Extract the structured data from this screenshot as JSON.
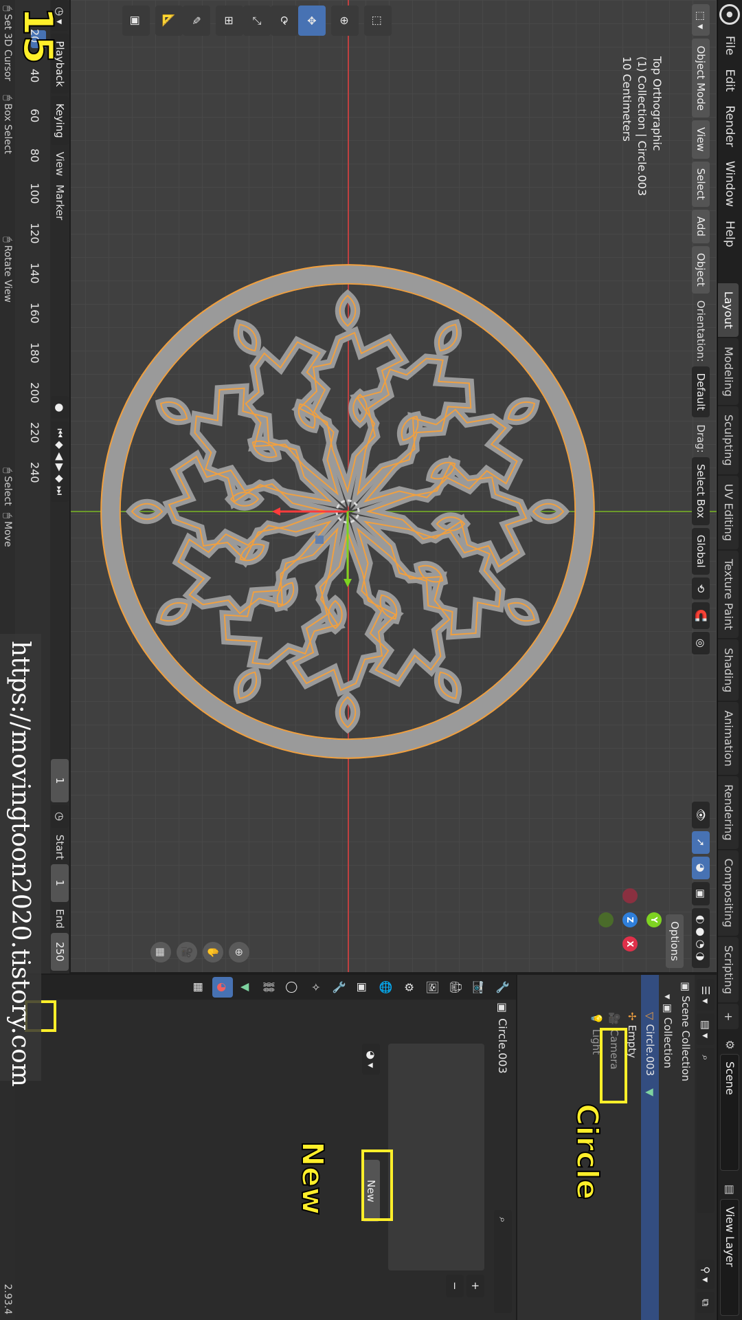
{
  "menu": {
    "items": [
      "File",
      "Edit",
      "Render",
      "Window",
      "Help"
    ]
  },
  "workspaces": [
    "Layout",
    "Modeling",
    "Sculpting",
    "UV Editing",
    "Texture Paint",
    "Shading",
    "Animation",
    "Rendering",
    "Compositing",
    "Scripting"
  ],
  "workspace_add": "+",
  "scene_name": "Scene",
  "view_layer_name": "View Layer",
  "header": {
    "mode": "Object Mode",
    "view": "View",
    "select": "Select",
    "add": "Add",
    "object": "Object",
    "orientation_label": "Orientation:",
    "orientation_value": "Default",
    "drag_label": "Drag:",
    "drag_value": "Select Box",
    "transform_value": "Global",
    "options": "Options"
  },
  "viewport_info": {
    "line1": "Top Orthographic",
    "line2": "(1) Collection | Circle.003",
    "line3": "10 Centimeters"
  },
  "gizmo": {
    "x": "X",
    "y": "Y",
    "z": "Z"
  },
  "timeline": {
    "playback": "Playback",
    "keying": "Keying",
    "view": "View",
    "marker": "Marker",
    "ticks": [
      "20",
      "40",
      "60",
      "80",
      "100",
      "120",
      "140",
      "160",
      "180",
      "200",
      "220",
      "240"
    ],
    "current_frame": "1",
    "start_label": "Start",
    "start_value": "1",
    "end_label": "End",
    "end_value": "250"
  },
  "status": {
    "set_cursor": "Set 3D Cursor",
    "box_select": "Box Select",
    "rotate_view": "Rotate View",
    "select": "Select",
    "move": "Move",
    "version": "2.93.4"
  },
  "outliner": {
    "scene_collection": "Scene Collection",
    "collection": "Collection",
    "items": [
      "Circle.003",
      "Empty",
      "Camera",
      "Light"
    ]
  },
  "properties": {
    "object_name": "Circle.003",
    "new_button": "New",
    "plus": "+",
    "minus": "−"
  },
  "annotations": {
    "step_number": "15",
    "circle_label": "Circle",
    "new_label": "New",
    "watermark": "https://movingtoon2020.tistory.com"
  },
  "colors": {
    "accent": "#4772b3",
    "selection": "#f0a040",
    "highlight": "#ffef2a"
  }
}
